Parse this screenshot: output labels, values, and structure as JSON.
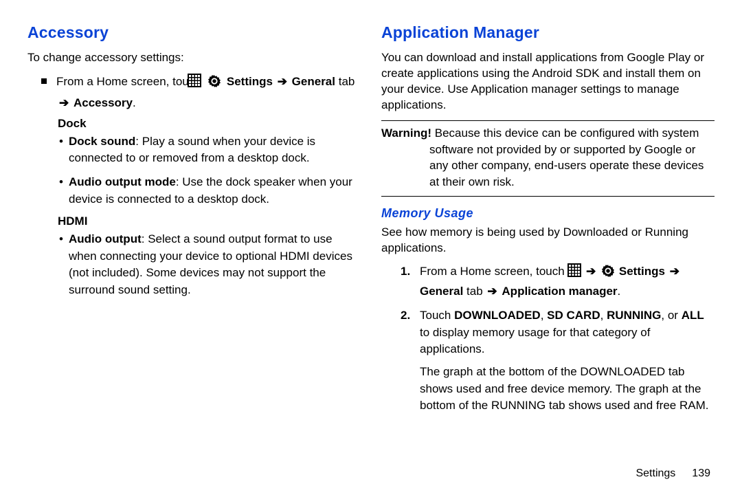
{
  "left": {
    "heading": "Accessory",
    "intro": "To change accessory settings:",
    "nav": {
      "prefix": "From a Home screen, touch",
      "settings_label": "Settings",
      "general_tab": "General",
      "tab_word": "tab",
      "dest": "Accessory"
    },
    "dock": {
      "title": "Dock",
      "items": [
        {
          "label": "Dock sound",
          "desc": ": Play a sound when your device is connected to or removed from a desktop dock."
        },
        {
          "label": "Audio output mode",
          "desc": ": Use the dock speaker when your device is connected to a desktop dock."
        }
      ]
    },
    "hdmi": {
      "title": "HDMI",
      "items": [
        {
          "label": "Audio output",
          "desc": ": Select a sound output format to use when connecting your device to optional HDMI devices (not included). Some devices may not support the surround sound setting."
        }
      ]
    }
  },
  "right": {
    "heading": "Application Manager",
    "intro": "You can download and install applications from Google Play or create applications using the Android SDK and install them on your device. Use Application manager settings to manage applications.",
    "warning_label": "Warning!",
    "warning_text": "Because this device can be configured with system software not provided by or supported by Google or any other company, end-users operate these devices at their own risk.",
    "memory": {
      "heading": "Memory Usage",
      "intro": "See how memory is being used by Downloaded or Running applications.",
      "step1": {
        "prefix": "From a Home screen, touch",
        "settings_label": "Settings",
        "general_tab": "General",
        "tab_word": "tab",
        "dest": "Application manager"
      },
      "step2": {
        "prefix": "Touch ",
        "downloaded": "DOWNLOADED",
        "sdcard": "SD CARD",
        "running": "RUNNING",
        "all": "ALL",
        "suffix": " to display memory usage for that category of applications.",
        "extra": "The graph at the bottom of the DOWNLOADED tab shows used and free device memory. The graph at the bottom of the RUNNING tab shows used and free RAM."
      }
    }
  },
  "footer": {
    "section": "Settings",
    "page": "139"
  },
  "glyphs": {
    "arrow": "➔"
  }
}
